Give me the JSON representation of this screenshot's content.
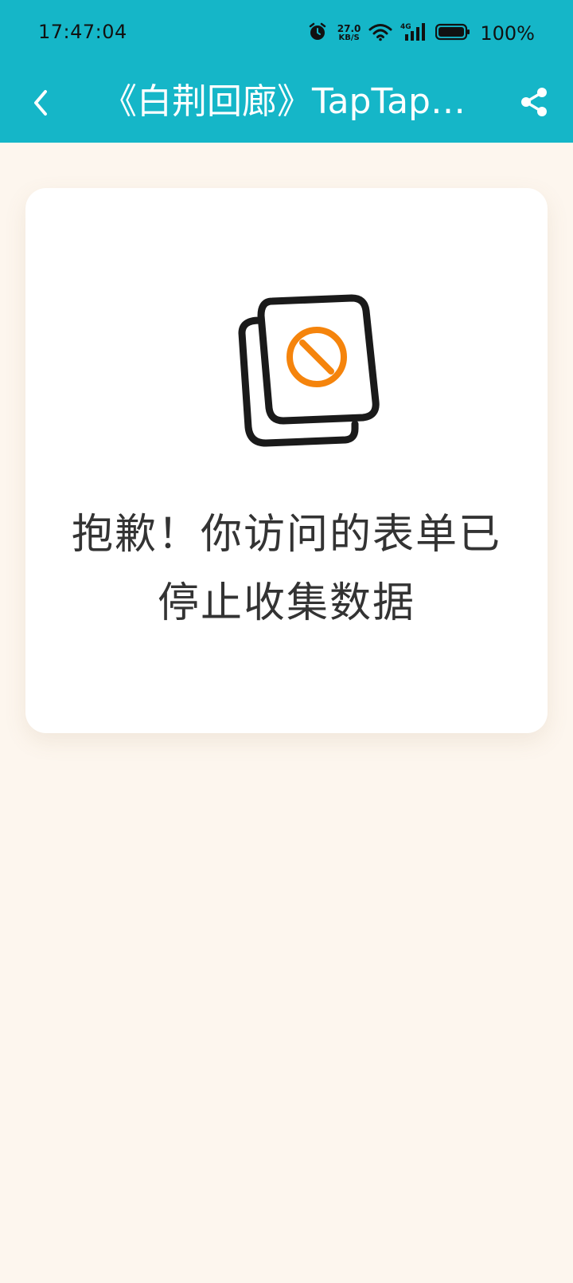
{
  "status_bar": {
    "time": "17:47:04",
    "net_speed_value": "27.0",
    "net_speed_unit": "KB/S",
    "network_type": "4G",
    "battery_percent": "100%"
  },
  "app_bar": {
    "title": "《白荆回廊》TapTap…",
    "background_color": "#15b6c8"
  },
  "card": {
    "message": "抱歉！你访问的表单已停止收集数据",
    "illustration": "stopped-form-icon",
    "accent_color": "#f5840c"
  },
  "page": {
    "background_color": "#fdf6ee"
  }
}
